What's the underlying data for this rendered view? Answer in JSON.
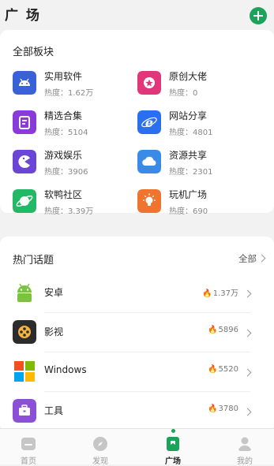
{
  "header": {
    "title": "广 场"
  },
  "all_sections": {
    "title": "全部板块",
    "items": [
      {
        "name": "实用软件",
        "heat": "热度：1.62万",
        "icon": "android-icon",
        "color": "#3a62d8"
      },
      {
        "name": "原创大佬",
        "heat": "热度：0",
        "icon": "star-badge-icon",
        "color": "#e2367a"
      },
      {
        "name": "精选合集",
        "heat": "热度：5104",
        "icon": "collection-icon",
        "color": "#8a3ad8"
      },
      {
        "name": "网站分享",
        "heat": "热度：4801",
        "icon": "browser-e-icon",
        "color": "#2a6ff0"
      },
      {
        "name": "游戏娱乐",
        "heat": "热度：3906",
        "icon": "pacman-icon",
        "color": "#6b46d6"
      },
      {
        "name": "资源共享",
        "heat": "热度：2301",
        "icon": "cloud-icon",
        "color": "#3a8ae8"
      },
      {
        "name": "软鸭社区",
        "heat": "热度：3.39万",
        "icon": "planet-icon",
        "color": "#22b866"
      },
      {
        "name": "玩机广场",
        "heat": "热度：690",
        "icon": "bulb-icon",
        "color": "#f0732e"
      }
    ]
  },
  "hot_topics": {
    "title": "热门话题",
    "all_label": "全部",
    "items": [
      {
        "name": "安卓",
        "count": "1.37万",
        "icon": "android-robot-icon"
      },
      {
        "name": "影视",
        "count": "5896",
        "icon": "film-reel-icon"
      },
      {
        "name": "Windows",
        "count": "5520",
        "icon": "windows-icon"
      },
      {
        "name": "工具",
        "count": "3780",
        "icon": "toolbox-icon"
      }
    ]
  },
  "tabbar": {
    "tabs": [
      {
        "label": "首页"
      },
      {
        "label": "发现"
      },
      {
        "label": "广场"
      },
      {
        "label": "我的"
      }
    ]
  }
}
